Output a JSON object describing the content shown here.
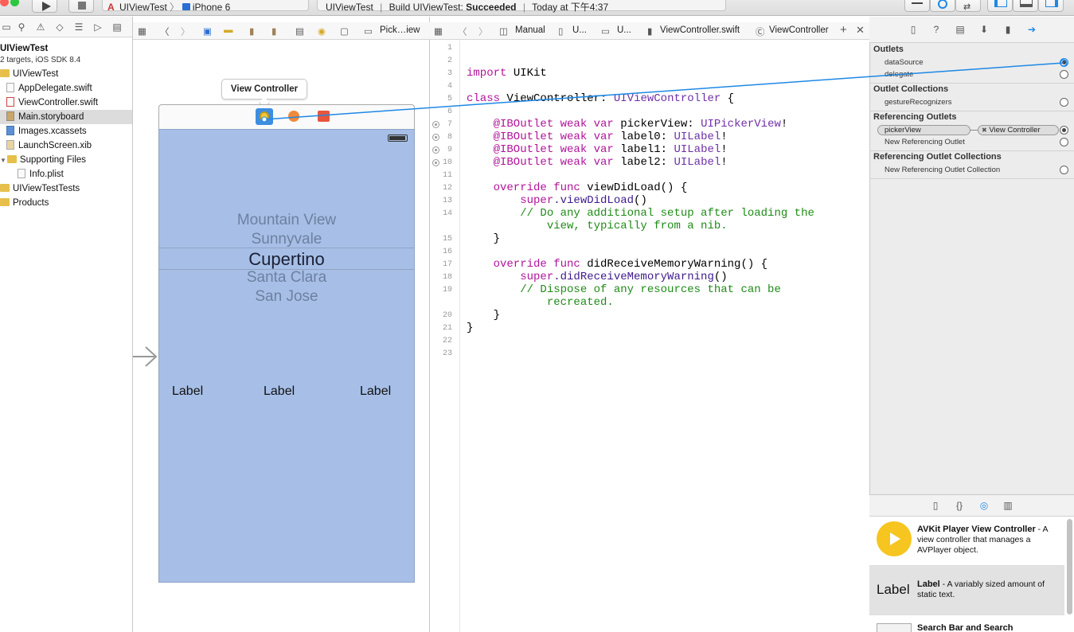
{
  "toolbar": {
    "scheme_project": "UIViewTest",
    "scheme_device": "iPhone 6",
    "status_project": "UIViewTest",
    "status_build": "Build UIViewTest:",
    "status_result": "Succeeded",
    "status_time": "Today at 下午4:37"
  },
  "navigator": {
    "project_name": "UIViewTest",
    "project_sub": "2 targets, iOS SDK 8.4",
    "items": [
      {
        "label": "UIViewTest"
      },
      {
        "label": "AppDelegate.swift"
      },
      {
        "label": "ViewController.swift"
      },
      {
        "label": "Main.storyboard"
      },
      {
        "label": "Images.xcassets"
      },
      {
        "label": "LaunchScreen.xib"
      },
      {
        "label": "Supporting Files"
      },
      {
        "label": "Info.plist"
      },
      {
        "label": "UIViewTestTests"
      },
      {
        "label": "Products"
      }
    ]
  },
  "canvas": {
    "jump_last": "Pick…iew",
    "scene_tip": "View Controller",
    "picker_rows": [
      "Mountain View",
      "Sunnyvale",
      "Cupertino",
      "Santa Clara",
      "San Jose"
    ],
    "labels": [
      "Label",
      "Label",
      "Label"
    ]
  },
  "editor": {
    "jump_items": [
      "Manual",
      "U...",
      "U...",
      "ViewController.swift",
      "ViewController"
    ],
    "line_numbers": [
      "1",
      "2",
      "3",
      "4",
      "5",
      "6",
      "7",
      "8",
      "9",
      "10",
      "11",
      "12",
      "13",
      "14",
      "15",
      "16",
      "17",
      "18",
      "19",
      "20",
      "21",
      "22",
      "23"
    ],
    "code": {
      "l3_kw": "import",
      "l3_rest": " UIKit",
      "l5_kw": "class",
      "l5_name": " ViewController",
      "l5_colon": ": ",
      "l5_type": "UIViewController",
      "l5_brace": " {",
      "l7_a": "    @IBOutlet weak var",
      "l7_b": " pickerView: ",
      "l7_c": "UIPickerView",
      "l7_d": "!",
      "l8_a": "    @IBOutlet weak var",
      "l8_b": " label0: ",
      "l8_c": "UILabel",
      "l8_d": "!",
      "l9_a": "    @IBOutlet weak var",
      "l9_b": " label1: ",
      "l9_c": "UILabel",
      "l9_d": "!",
      "l10_a": "    @IBOutlet weak var",
      "l10_b": " label2: ",
      "l10_c": "UILabel",
      "l10_d": "!",
      "l12_a": "    override func",
      "l12_b": " viewDidLoad() {",
      "l13_a": "        super",
      "l13_b": ".viewDidLoad",
      "l13_c": "()",
      "l14": "        // Do any additional setup after loading the",
      "l14b": "            view, typically from a nib.",
      "l15": "    }",
      "l17_a": "    override func",
      "l17_b": " didReceiveMemoryWarning() {",
      "l18_a": "        super",
      "l18_b": ".didReceiveMemoryWarning",
      "l18_c": "()",
      "l19": "        // Dispose of any resources that can be",
      "l19b": "            recreated.",
      "l20": "    }",
      "l21": "}"
    }
  },
  "inspector": {
    "outlets_title": "Outlets",
    "outlet_1": "dataSource",
    "outlet_2": "delegate",
    "collections_title": "Outlet Collections",
    "collection_1": "gestureRecognizers",
    "ref_title": "Referencing Outlets",
    "ref_from": "pickerView",
    "ref_to": "View Controller",
    "ref_new": "New Referencing Outlet",
    "refcol_title": "Referencing Outlet Collections",
    "refcol_new": "New Referencing Outlet Collection"
  },
  "library": {
    "items": [
      {
        "name": "AVKit Player View Controller",
        "desc": " - A view controller that manages a AVPlayer object."
      },
      {
        "name": "Label",
        "desc": " - A variably sized amount of static text.",
        "icon_text": "Label"
      },
      {
        "name": "Search Bar and Search",
        "desc": ""
      }
    ]
  },
  "colors": {
    "accent": "#1e88e5",
    "view_bg": "#a7bfe6",
    "keyword": "#b0149a",
    "comment": "#1f8b17"
  }
}
